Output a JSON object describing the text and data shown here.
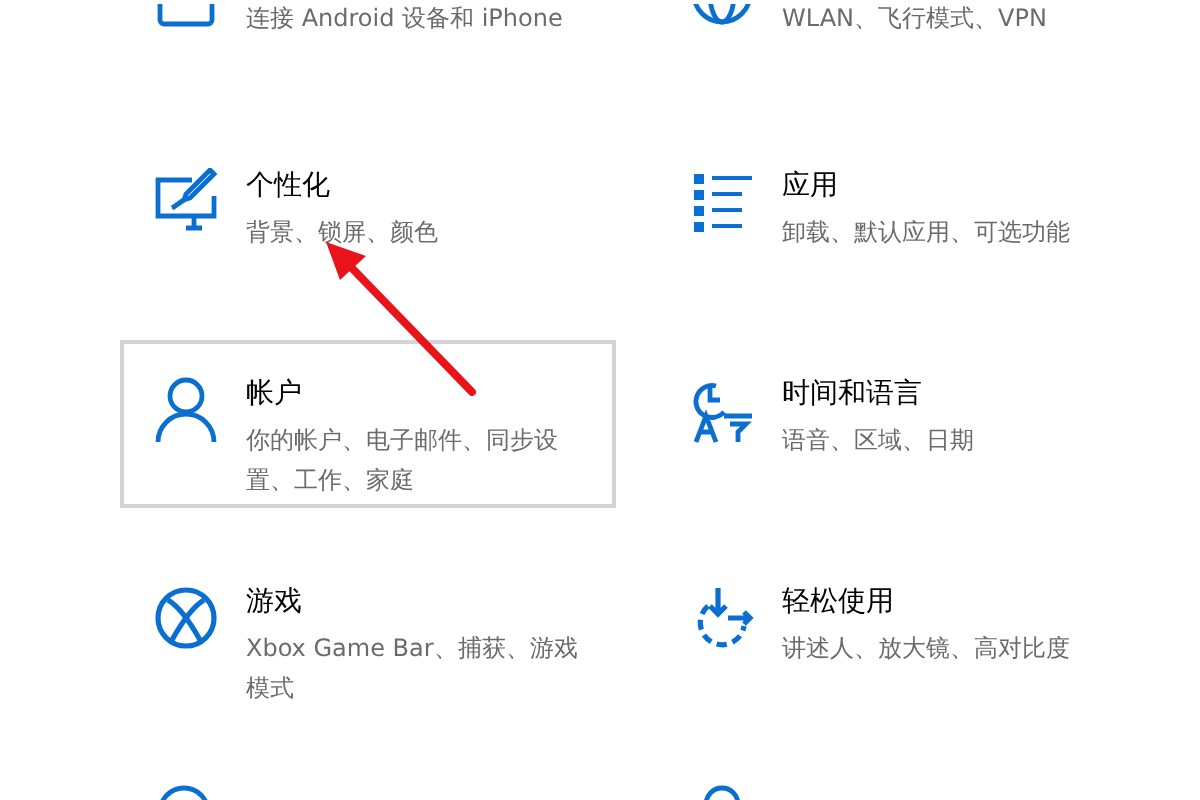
{
  "settings_tiles": [
    {
      "description": "连接 Android 设备和 iPhone",
      "hovered": false
    },
    {
      "description": "WLAN、飞行模式、VPN",
      "hovered": false
    },
    {
      "title": "个性化",
      "description": "背景、锁屏、颜色",
      "hovered": false
    },
    {
      "title": "应用",
      "description": "卸载、默认应用、可选功能",
      "hovered": false
    },
    {
      "title": "帐户",
      "description": "你的帐户、电子邮件、同步设置、工作、家庭",
      "hovered": true
    },
    {
      "title": "时间和语言",
      "description": "语音、区域、日期",
      "hovered": false
    },
    {
      "title": "游戏",
      "description": "Xbox Game Bar、捕获、游戏模式",
      "hovered": false
    },
    {
      "title": "轻松使用",
      "description": "讲述人、放大镜、高对比度",
      "hovered": false
    },
    {
      "hovered": false
    },
    {
      "hovered": false
    }
  ],
  "annotation": {
    "kind": "arrow",
    "color": "#e8141a"
  }
}
